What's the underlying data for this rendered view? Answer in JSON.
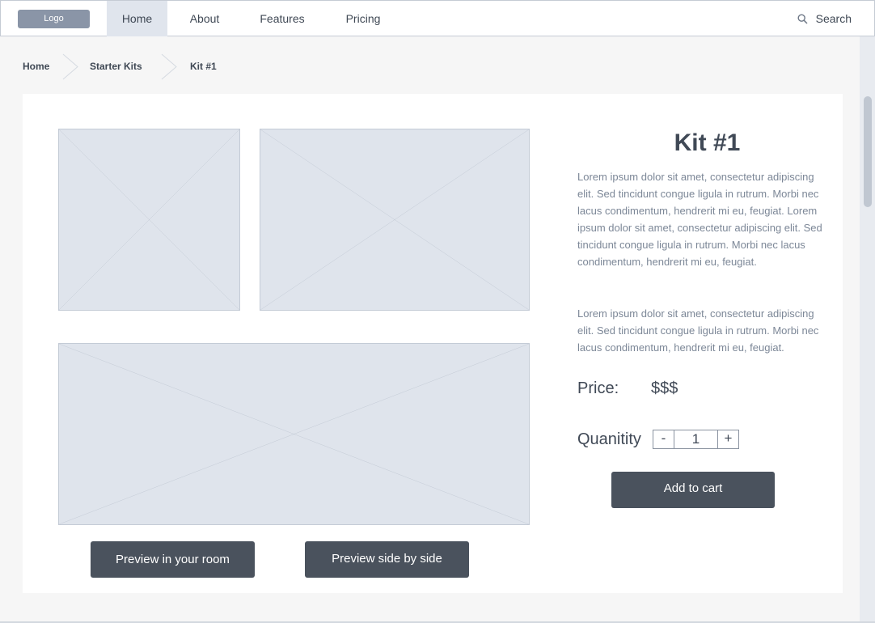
{
  "nav": {
    "logo": "Logo",
    "items": [
      {
        "label": "Home",
        "active": true
      },
      {
        "label": "About",
        "active": false
      },
      {
        "label": "Features",
        "active": false
      },
      {
        "label": "Pricing",
        "active": false
      }
    ],
    "search_label": "Search",
    "search_icon": "search-icon"
  },
  "breadcrumb": [
    "Home",
    "Starter Kits",
    "Kit #1"
  ],
  "product": {
    "title": "Kit #1",
    "description_1": "Lorem ipsum dolor sit amet, consectetur adipiscing elit. Sed tincidunt congue ligula in rutrum. Morbi nec lacus condimentum, hendrerit mi eu, feugiat. Lorem ipsum dolor sit amet, consectetur adipiscing elit. Sed tincidunt congue ligula in rutrum. Morbi nec lacus condimentum, hendrerit mi eu, feugiat.",
    "description_2": "Lorem ipsum dolor sit amet, consectetur adipiscing elit. Sed tincidunt congue ligula in rutrum. Morbi nec lacus condimentum, hendrerit mi eu, feugiat.",
    "price_label": "Price:",
    "price_value": "$$$",
    "quantity_label": "Quanitity",
    "quantity_value": "1",
    "decrement": "-",
    "increment": "+",
    "add_to_cart": "Add to cart"
  },
  "actions": {
    "preview_room": "Preview in your room",
    "preview_side": "Preview side by side"
  },
  "colors": {
    "accent_dark": "#4a525d",
    "placeholder": "#dfe4ec",
    "nav_active": "#e0e5ed"
  }
}
